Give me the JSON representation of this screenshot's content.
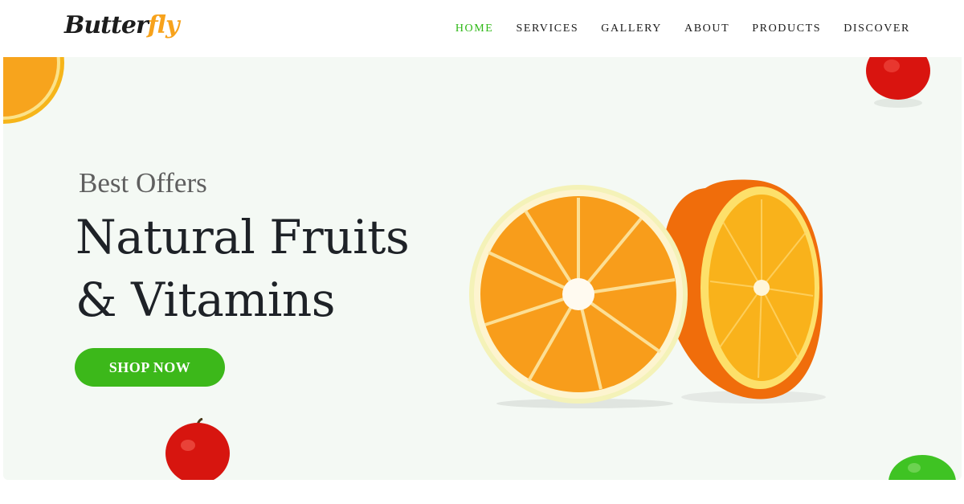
{
  "brand": {
    "logo_part1": "Butter",
    "logo_part2": "fly",
    "accent_color": "#3cb81a",
    "logo_accent_color": "#f7a21b"
  },
  "nav": {
    "items": [
      {
        "label": "HOME",
        "active": true
      },
      {
        "label": "SERVICES",
        "active": false
      },
      {
        "label": "GALLERY",
        "active": false
      },
      {
        "label": "ABOUT",
        "active": false
      },
      {
        "label": "PRODUCTS",
        "active": false
      },
      {
        "label": "DISCOVER",
        "active": false
      }
    ]
  },
  "hero": {
    "subtitle": "Best Offers",
    "title_line1": "Natural Fruits",
    "title_line2": "& Vitamins",
    "cta_label": "SHOP NOW",
    "background_color": "#f4f9f4"
  },
  "images": {
    "main": "halved-orange-image",
    "decor": [
      "orange-slice-image",
      "red-apple-image",
      "red-apple-image",
      "green-apple-image"
    ]
  }
}
